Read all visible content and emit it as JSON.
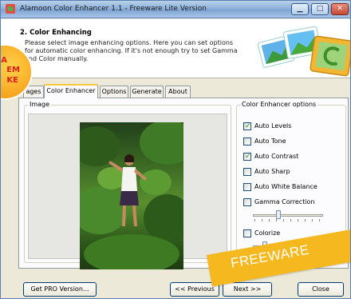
{
  "window": {
    "title": "Alamoon Color Enhancer 1.1 - Freeware Lite Version",
    "minimize_symbol": "▁",
    "maximize_symbol": "□",
    "close_symbol": "✕"
  },
  "header": {
    "step_title": "2. Color Enhancing",
    "description": "Please select image enhancing options. Here you can set options for automatic color enhancing. If it's not enough try to set Gamma and Color manually."
  },
  "promo_badge": {
    "line1": "A",
    "line2": "EM",
    "line3": "KE"
  },
  "tabs": [
    {
      "label": "ages",
      "active": false
    },
    {
      "label": "Color Enhancer",
      "active": true
    },
    {
      "label": "Options",
      "active": false
    },
    {
      "label": "Generate",
      "active": false
    },
    {
      "label": "About",
      "active": false
    }
  ],
  "image_group": {
    "label": "Image"
  },
  "options_group": {
    "label": "Color Enhancer options",
    "items": [
      {
        "label": "Auto Levels",
        "checked": true
      },
      {
        "label": "Auto Tone",
        "checked": false
      },
      {
        "label": "Auto Contrast",
        "checked": true
      },
      {
        "label": "Auto Sharp",
        "checked": false
      },
      {
        "label": "Auto White Balance",
        "checked": false
      },
      {
        "label": "Gamma Correction",
        "checked": false
      },
      {
        "label": "Colorize",
        "checked": false
      }
    ],
    "gamma_slider_level": 0.35,
    "colorize_slider_level": 0.15
  },
  "buttons": {
    "get_pro": "Get PRO Version...",
    "previous": "<< Previous",
    "next": "Next >>",
    "close": "Close"
  },
  "ribbon": {
    "text": "FREEWARE"
  },
  "colors": {
    "accent_tab": "#ffc83c",
    "ribbon": "#f5b81e",
    "badge_text": "#d9201c"
  }
}
